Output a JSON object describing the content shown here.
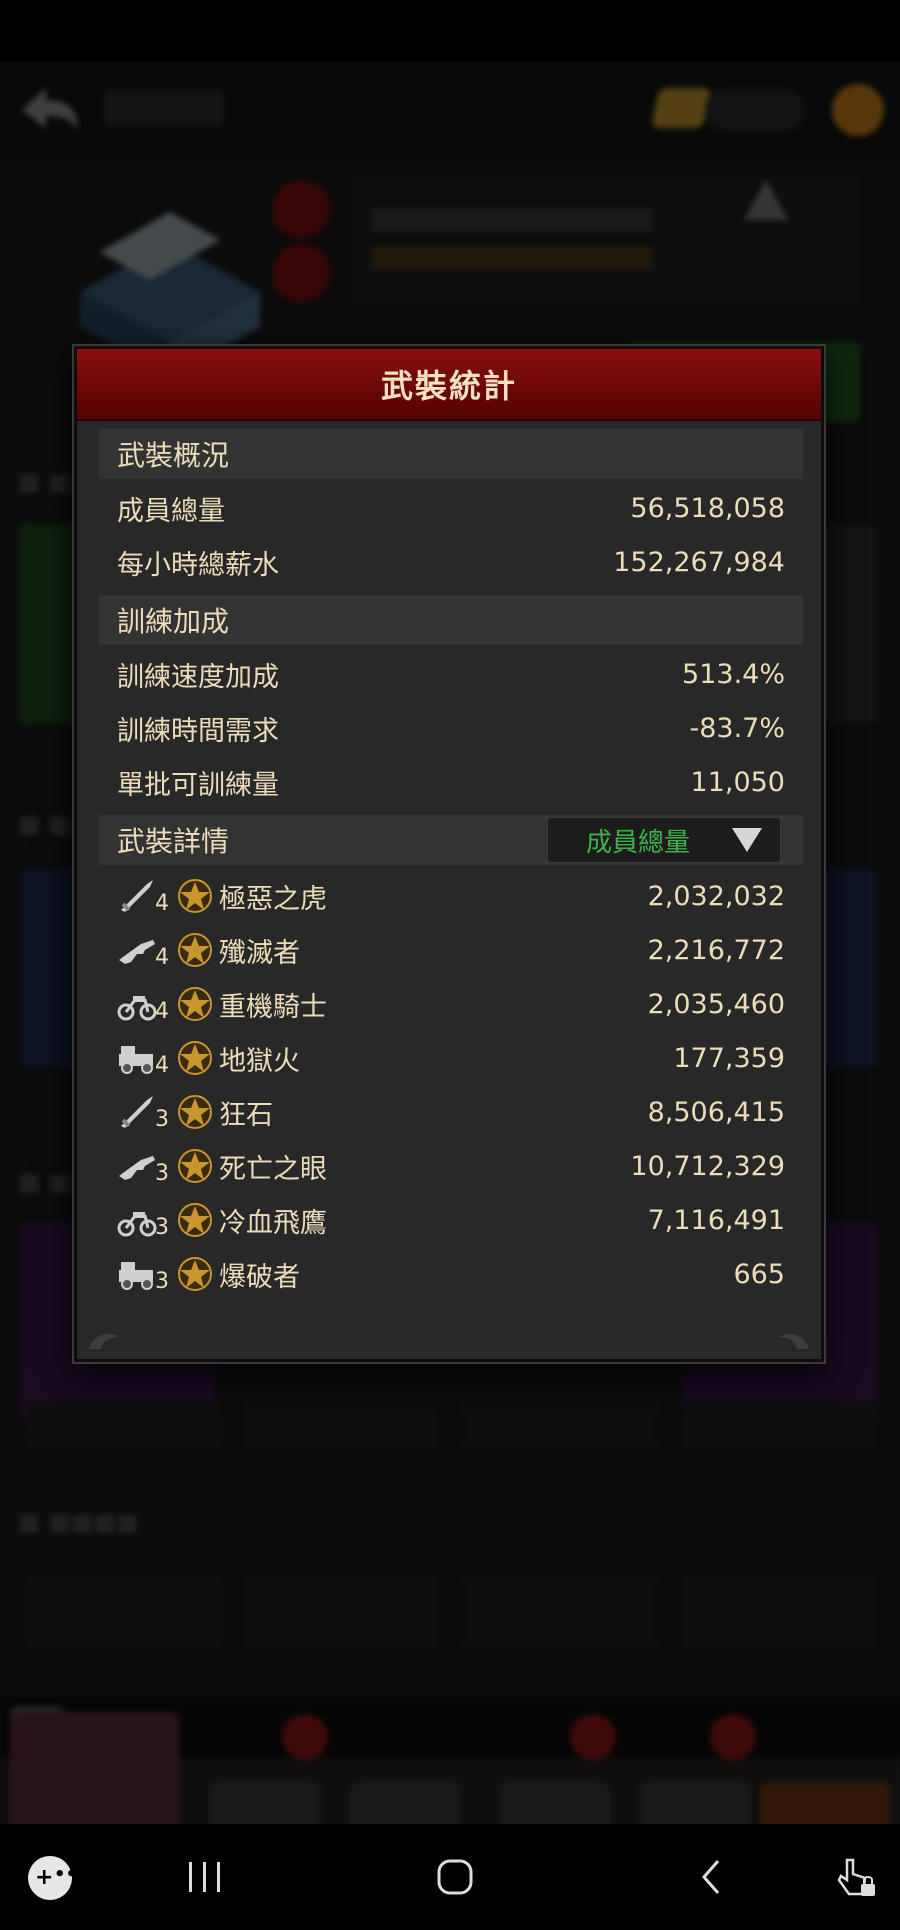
{
  "dialog": {
    "title": "武裝統計",
    "sections": {
      "overview": {
        "title": "武裝概況",
        "rows": [
          {
            "label": "成員總量",
            "value": "56,518,058"
          },
          {
            "label": "每小時總薪水",
            "value": "152,267,984"
          }
        ]
      },
      "training": {
        "title": "訓練加成",
        "rows": [
          {
            "label": "訓練速度加成",
            "value": "513.4%"
          },
          {
            "label": "訓練時間需求",
            "value": "-83.7%"
          },
          {
            "label": "單批可訓練量",
            "value": "11,050"
          }
        ]
      },
      "details": {
        "title": "武裝詳情",
        "sort_option": "成員總量",
        "units": [
          {
            "weapon": "blade-icon",
            "tier": "4",
            "name": "極惡之虎",
            "count": "2,032,032"
          },
          {
            "weapon": "rifle-icon",
            "tier": "4",
            "name": "殲滅者",
            "count": "2,216,772"
          },
          {
            "weapon": "motorbike-icon",
            "tier": "4",
            "name": "重機騎士",
            "count": "2,035,460"
          },
          {
            "weapon": "truck-icon",
            "tier": "4",
            "name": "地獄火",
            "count": "177,359"
          },
          {
            "weapon": "blade-icon",
            "tier": "3",
            "name": "狂石",
            "count": "8,506,415"
          },
          {
            "weapon": "rifle-icon",
            "tier": "3",
            "name": "死亡之眼",
            "count": "10,712,329"
          },
          {
            "weapon": "motorbike-icon",
            "tier": "3",
            "name": "冷血飛鷹",
            "count": "7,116,491"
          },
          {
            "weapon": "truck-icon",
            "tier": "3",
            "name": "爆破者",
            "count": "665"
          }
        ]
      }
    }
  },
  "colors": {
    "header_red": "#7a0a0a",
    "text_cream": "#ecdcb8",
    "sort_green": "#3bb44a",
    "star_gold": "#c9952e"
  }
}
